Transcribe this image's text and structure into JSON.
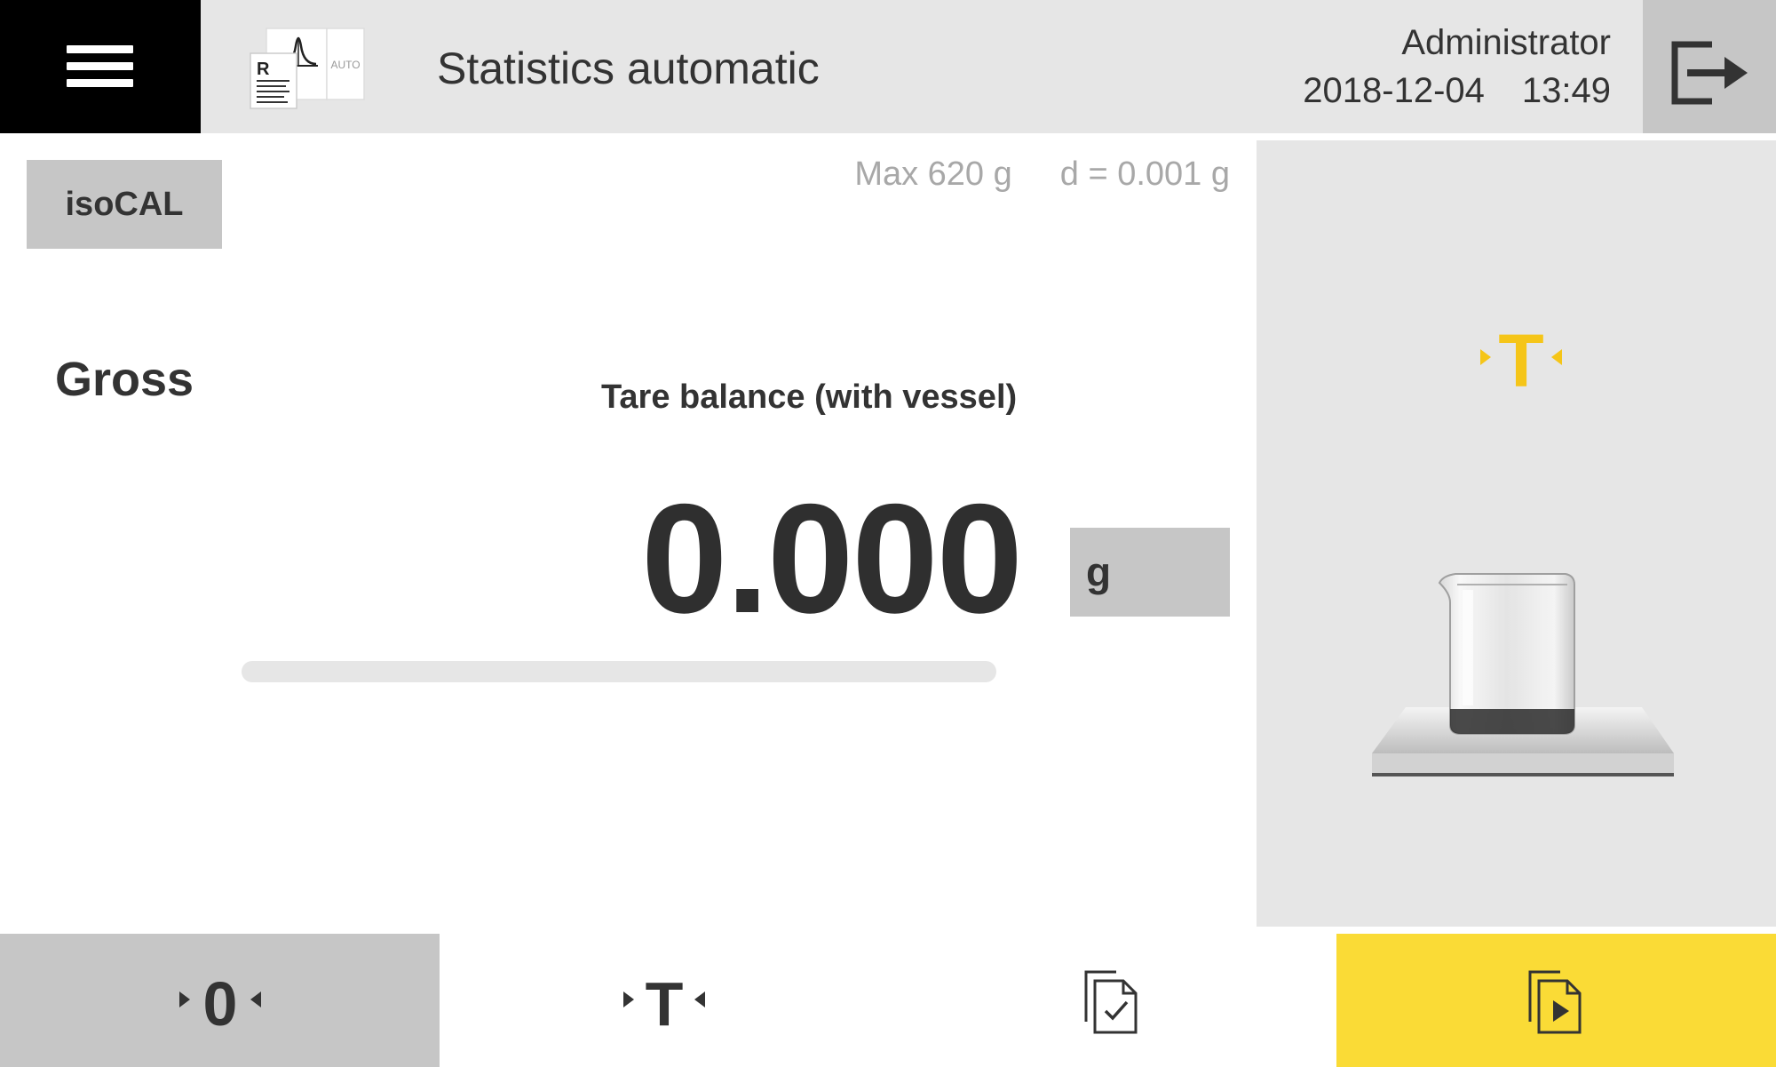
{
  "header": {
    "title": "Statistics automatic",
    "app_icon": "statistics-automatic-icon",
    "app_icon_letter": "R",
    "app_icon_badge": "AUTO",
    "user": "Administrator",
    "date": "2018-12-04",
    "time": "13:49",
    "menu_icon": "hamburger-menu-icon",
    "logout_icon": "logout-icon"
  },
  "main": {
    "isocal_label": "isoCAL",
    "max_capacity": "Max 620 g",
    "readability": "d = 0.001 g",
    "mode_label": "Gross",
    "instruction": "Tare balance (with vessel)",
    "weight_value": "0.000",
    "unit": "g",
    "capacity_used_fraction": 0.0
  },
  "right_panel": {
    "hint_icon": "tare-icon",
    "hint_label": "T",
    "illustration": "beaker-on-weighing-pan",
    "accent_color": "#f5c518"
  },
  "bottom_bar": {
    "zero_button": {
      "icon": "zero-icon",
      "label": "0"
    },
    "tare_button": {
      "icon": "tare-icon",
      "label": "T"
    },
    "confirm_button": {
      "icon": "confirm-document-icon"
    },
    "start_button": {
      "icon": "start-document-icon",
      "color": "#fadb36"
    }
  }
}
